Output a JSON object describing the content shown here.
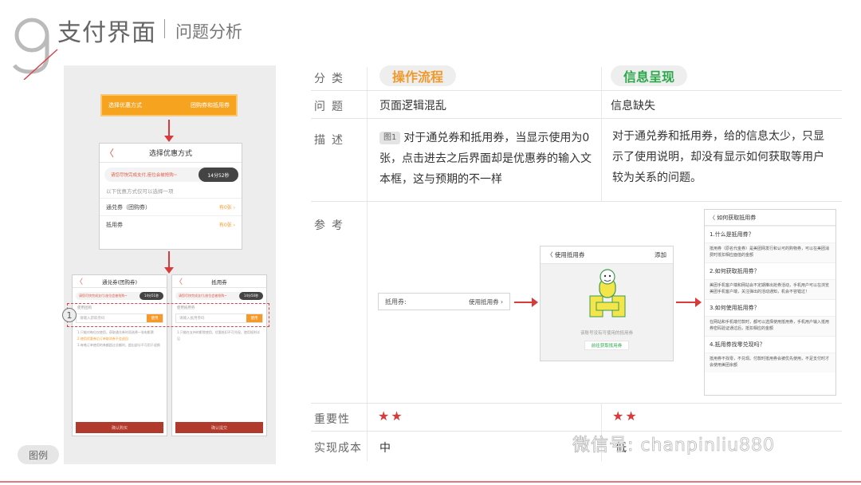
{
  "header": {
    "number": "9",
    "title": "支付界面",
    "subtitle": "问题分析"
  },
  "illustration": {
    "top_bar": {
      "left": "选择优惠方式",
      "right": "团购券和抵用券"
    },
    "screen1": {
      "back": "〈",
      "title": "选择优惠方式",
      "notice": "请您尽快完成支付,座位会被抢购~",
      "timer": "14分52秒",
      "hint": "以下优惠方式仅可以选择一项",
      "rows": [
        {
          "label": "通兑券（团购券）",
          "value": "有0张"
        },
        {
          "label": "抵用券",
          "value": "有0张"
        }
      ]
    },
    "screen2": {
      "back": "〈",
      "title": "通兑券(团购券)",
      "notice": "请您尽快完成支付,座位会被抢购~",
      "timer": "14分51秒",
      "input_label": "使用团购",
      "input_placeholder": "请输入获取券码",
      "button": "使用",
      "lines": [
        "1.只能对每位仅使用，获取通兑券时须选择一张电影票",
        "2.使用优惠券后订单取消券不会退回",
        "3.每笔订单使用的券额超过总额时，超出部分不可用于退换"
      ],
      "footer": "确认购买"
    },
    "screen3": {
      "back": "〈",
      "title": "抵用券",
      "notice": "请您尽快完成支付,座位会被抢购~",
      "timer": "14分50秒",
      "input_label": "使用抵用券",
      "input_placeholder": "请输入抵用券码",
      "button": "使用",
      "lines": [
        "1.只能在支持的影院使用，优惠抵扣不可兑现，使用规则详见"
      ],
      "footer": "确认提交"
    },
    "marker": "1",
    "caption": "图例"
  },
  "table": {
    "labels": {
      "category": "分类",
      "problem": "问题",
      "description": "描述",
      "reference": "参考",
      "importance": "重要性",
      "cost": "实现成本"
    },
    "col1": {
      "category": "操作流程",
      "problem": "页面逻辑混乱",
      "fig_tag": "图1",
      "description": "对于通兑券和抵用券，当显示使用为0张，点击进去之后界面却是优惠券的输入文本框，这与预期的不一样",
      "importance_stars": "★★",
      "importance": 2,
      "cost": "中"
    },
    "col2": {
      "category": "信息呈现",
      "problem": "信息缺失",
      "description": "对于通兑券和抵用券，给的信息太少，只显示了使用说明，却没有显示如何获取等用户较为关系的问题。",
      "importance_stars": "★★",
      "importance": 2,
      "cost": "低"
    }
  },
  "reference": {
    "input": {
      "label": "抵用券:",
      "value": "使用抵用券 ›"
    },
    "phone1": {
      "back": "〈",
      "title": "使用抵用券",
      "action": "添加",
      "empty_text": "该账号没有可使用的抵用券",
      "link": "前往获取抵用券"
    },
    "phone2": {
      "back": "〈",
      "title": "如何获取抵用券",
      "qa": [
        {
          "q": "1.什么是抵用券？",
          "a": "抵用券（原名代金券）是美团网发行和认可的购物券，可以在美团消费时抵扣相应面值的金额"
        },
        {
          "q": "2.如何获取抵用券？",
          "a": "美团手机客户端和网站会不定期推出抢券活动，手机用户可以在浏览美团手机客户端，关注弹出的活动通知，机会不容错过！"
        },
        {
          "q": "3.如何使用抵用券？",
          "a": "在网站和手机端付款时，都可以选择使用抵用券，手机用户输入抵用券密码验证通过后，抵扣相应的金额"
        },
        {
          "q": "4.抵用券找零兑现吗？",
          "a": "抵用券不找零，不兑现。付款时抵用券会被优先使用，不足支付时才会使用美团余额"
        }
      ]
    }
  },
  "watermark": "微信号: chanpinliu880",
  "colors": {
    "orange": "#f09a2e",
    "green": "#2aa84a",
    "red": "#d73b3b"
  }
}
